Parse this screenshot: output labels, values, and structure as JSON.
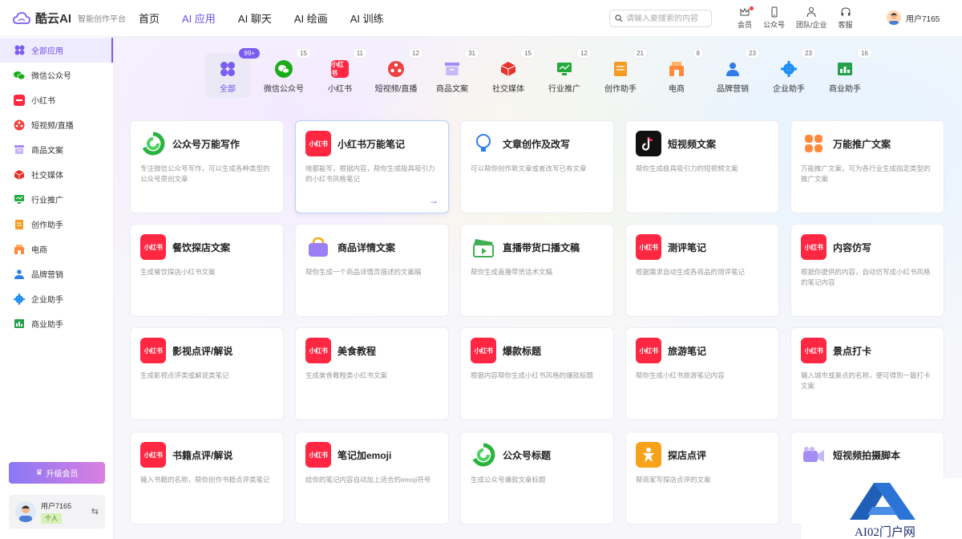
{
  "header": {
    "brand": "酷云AI",
    "tagline": "智能创作平台",
    "nav": [
      "首页",
      "AI 应用",
      "AI 聊天",
      "AI 绘画",
      "AI 训练"
    ],
    "search_placeholder": "请输入要搜索的内容",
    "icons": [
      {
        "label": "会员",
        "icon": "crown-icon"
      },
      {
        "label": "公众号",
        "icon": "phone-icon"
      },
      {
        "label": "团队/企业",
        "icon": "team-icon"
      },
      {
        "label": "客服",
        "icon": "headset-icon"
      }
    ],
    "user": "用户7165"
  },
  "sidebar": {
    "items": [
      {
        "label": "全部应用",
        "icon": "grid-icon"
      },
      {
        "label": "微信公众号",
        "icon": "wechat-icon"
      },
      {
        "label": "小红书",
        "icon": "xiaohongshu-icon"
      },
      {
        "label": "短视频/直播",
        "icon": "video-icon"
      },
      {
        "label": "商品文案",
        "icon": "product-icon"
      },
      {
        "label": "社交媒体",
        "icon": "cube-icon"
      },
      {
        "label": "行业推广",
        "icon": "monitor-icon"
      },
      {
        "label": "创作助手",
        "icon": "doc-icon"
      },
      {
        "label": "电商",
        "icon": "shop-icon"
      },
      {
        "label": "品牌营销",
        "icon": "people-icon"
      },
      {
        "label": "企业助手",
        "icon": "gear-icon"
      },
      {
        "label": "商业助手",
        "icon": "chart-icon"
      }
    ],
    "upgrade": "升级会员",
    "user_name": "用户7165",
    "user_badge": "个人",
    "switch": "⇆"
  },
  "categories": [
    {
      "label": "全部",
      "count": "99+"
    },
    {
      "label": "微信公众号",
      "count": "15"
    },
    {
      "label": "小红书",
      "count": "11"
    },
    {
      "label": "短视频/直播",
      "count": "12"
    },
    {
      "label": "商品文案",
      "count": "31"
    },
    {
      "label": "社交媒体",
      "count": "15"
    },
    {
      "label": "行业推广",
      "count": "12"
    },
    {
      "label": "创作助手",
      "count": "21"
    },
    {
      "label": "电商",
      "count": "8"
    },
    {
      "label": "品牌营销",
      "count": "23"
    },
    {
      "label": "企业助手",
      "count": "23"
    },
    {
      "label": "商业助手",
      "count": "16"
    }
  ],
  "cards": [
    {
      "title": "公众号万能写作",
      "desc": "专注微信公众号写作，可以生成各种类型的公众号原创文章",
      "icon": "wechat-ring-icon"
    },
    {
      "title": "小红书万能笔记",
      "desc": "啥都能写，根据内容，帮你生成极具吸引力的小红书风格笔记",
      "icon": "xiaohongshu-icon"
    },
    {
      "title": "文章创作及改写",
      "desc": "可以帮你创作新文章或者改写已有文章",
      "icon": "bulb-icon"
    },
    {
      "title": "短视频文案",
      "desc": "帮你生成极具吸引力的短视频文案",
      "icon": "tiktok-icon"
    },
    {
      "title": "万能推广文案",
      "desc": "万能推广文案，可为各行业生成指定类型的推广文案",
      "icon": "clover-icon"
    },
    {
      "title": "餐饮探店文案",
      "desc": "生成餐饮探店小红书文案",
      "icon": "xiaohongshu-icon"
    },
    {
      "title": "商品详情文案",
      "desc": "帮你生成一个商品详情页描述的文案稿",
      "icon": "bag-icon"
    },
    {
      "title": "直播带货口播文稿",
      "desc": "帮你生成直播带货话术文稿",
      "icon": "clapper-icon"
    },
    {
      "title": "测评笔记",
      "desc": "根据需求自动生成各商品的测评笔记",
      "icon": "xiaohongshu-icon"
    },
    {
      "title": "内容仿写",
      "desc": "根据你提供的内容，自动仿写成小红书风格的笔记内容",
      "icon": "xiaohongshu-icon"
    },
    {
      "title": "影视点评/解说",
      "desc": "生成影视点评类或解说类笔记",
      "icon": "xiaohongshu-icon"
    },
    {
      "title": "美食教程",
      "desc": "生成美食教程类小红书文案",
      "icon": "xiaohongshu-icon"
    },
    {
      "title": "爆款标题",
      "desc": "根据内容帮你生成小红书风格的爆款标题",
      "icon": "xiaohongshu-icon"
    },
    {
      "title": "旅游笔记",
      "desc": "帮你生成小红书旅游笔记内容",
      "icon": "xiaohongshu-icon"
    },
    {
      "title": "景点打卡",
      "desc": "输入城市或景点的名称，便可得到一篇打卡文案",
      "icon": "xiaohongshu-icon"
    },
    {
      "title": "书籍点评/解说",
      "desc": "输入书籍的名称，帮你创作书籍点评类笔记",
      "icon": "xiaohongshu-icon"
    },
    {
      "title": "笔记加emoji",
      "desc": "给你的笔记内容自动加上适合的emoji符号",
      "icon": "xiaohongshu-icon"
    },
    {
      "title": "公众号标题",
      "desc": "生成公众号爆款文章标题",
      "icon": "wechat-ring-icon"
    },
    {
      "title": "探店点评",
      "desc": "帮商家写探店点评的文案",
      "icon": "person-icon"
    },
    {
      "title": "短视频拍摄脚本",
      "desc": "",
      "icon": "camera-icon"
    }
  ],
  "xhs_text": "小红书",
  "watermark": "AI02门户网",
  "colors": {
    "accent": "#6c4de6",
    "xhs": "#ff2741"
  }
}
